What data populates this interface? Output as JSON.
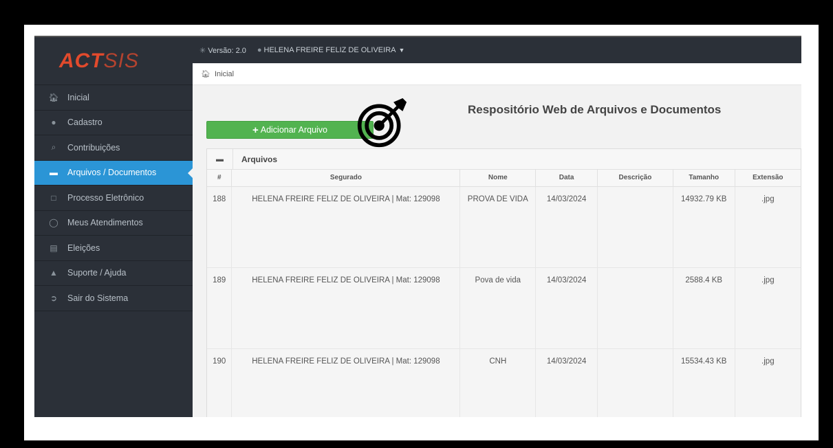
{
  "sidebar": {
    "logo_act": "ACT",
    "logo_sis": "SIS",
    "items": [
      {
        "label": "Inicial",
        "icon": "home-icon"
      },
      {
        "label": "Cadastro",
        "icon": "user-icon"
      },
      {
        "label": "Contribuições",
        "icon": "money-icon"
      },
      {
        "label": "Arquivos / Documentos",
        "icon": "drive-icon"
      },
      {
        "label": "Processo Eletrônico",
        "icon": "window-icon"
      },
      {
        "label": "Meus Atendimentos",
        "icon": "chat-icon"
      },
      {
        "label": "Eleições",
        "icon": "ballot-icon"
      },
      {
        "label": "Suporte / Ajuda",
        "icon": "warning-icon"
      },
      {
        "label": "Sair do Sistema",
        "icon": "logout-icon"
      }
    ],
    "active_index": 3
  },
  "topbar": {
    "version": "Versão: 2.0",
    "user": "HELENA FREIRE FELIZ DE OLIVEIRA"
  },
  "breadcrumb": {
    "current": "Inicial"
  },
  "main": {
    "title": "Respositório Web de Arquivos e Documentos",
    "add_button": "Adicionar Arquivo",
    "panel_title": "Arquivos"
  },
  "table": {
    "headers": [
      "#",
      "Segurado",
      "Nome",
      "Data",
      "Descrição",
      "Tamanho",
      "Extensão"
    ],
    "rows": [
      {
        "id": "188",
        "segurado": "HELENA FREIRE FELIZ DE OLIVEIRA | Mat: 129098",
        "nome": "PROVA DE VIDA",
        "data": "14/03/2024",
        "descricao": "",
        "tamanho": "14932.79 KB",
        "extensao": ".jpg"
      },
      {
        "id": "189",
        "segurado": "HELENA FREIRE FELIZ DE OLIVEIRA | Mat: 129098",
        "nome": "Pova de vida",
        "data": "14/03/2024",
        "descricao": "",
        "tamanho": "2588.4 KB",
        "extensao": ".jpg"
      },
      {
        "id": "190",
        "segurado": "HELENA FREIRE FELIZ DE OLIVEIRA | Mat: 129098",
        "nome": "CNH",
        "data": "14/03/2024",
        "descricao": "",
        "tamanho": "15534.43 KB",
        "extensao": ".jpg"
      }
    ]
  },
  "colors": {
    "sidebar_bg": "#2b3038",
    "active": "#2b95d6",
    "button": "#52b350",
    "logo": "#e24a2c"
  }
}
